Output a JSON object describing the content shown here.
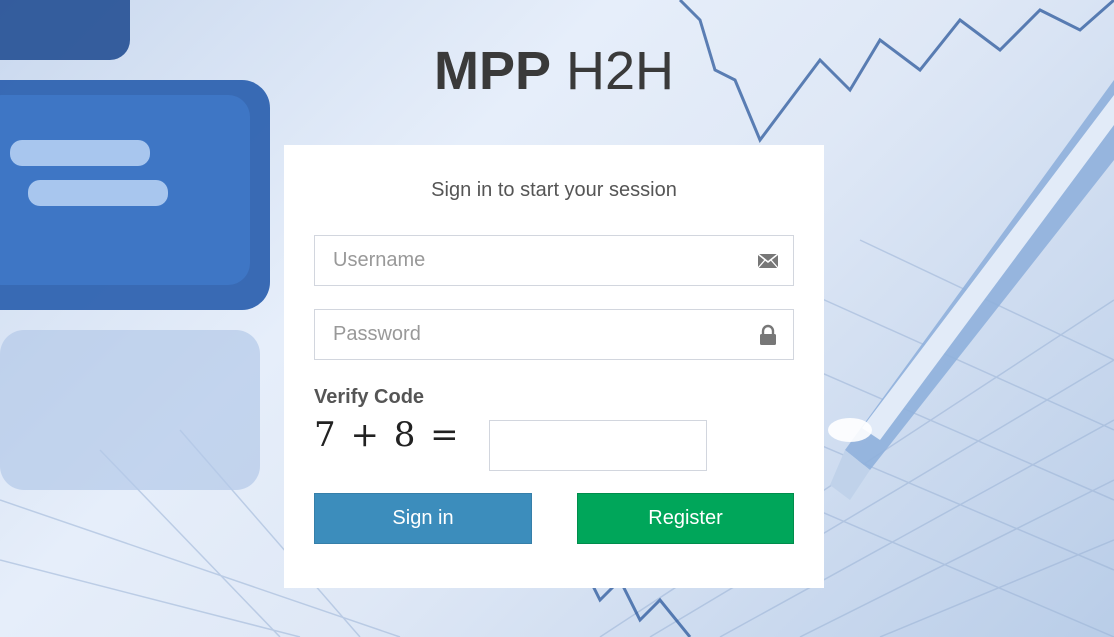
{
  "logo": {
    "bold": "MPP",
    "light": " H2H"
  },
  "login": {
    "message": "Sign in to start your session",
    "username_placeholder": "Username",
    "password_placeholder": "Password",
    "verify_label": "Verify Code",
    "captcha_text": "7 + 8 =",
    "code_value": "",
    "signin_label": "Sign in",
    "register_label": "Register"
  },
  "icons": {
    "username": "envelope-icon",
    "password": "lock-icon"
  },
  "colors": {
    "signin": "#3c8dbc",
    "register": "#00a65a",
    "box_bg": "#ffffff"
  }
}
